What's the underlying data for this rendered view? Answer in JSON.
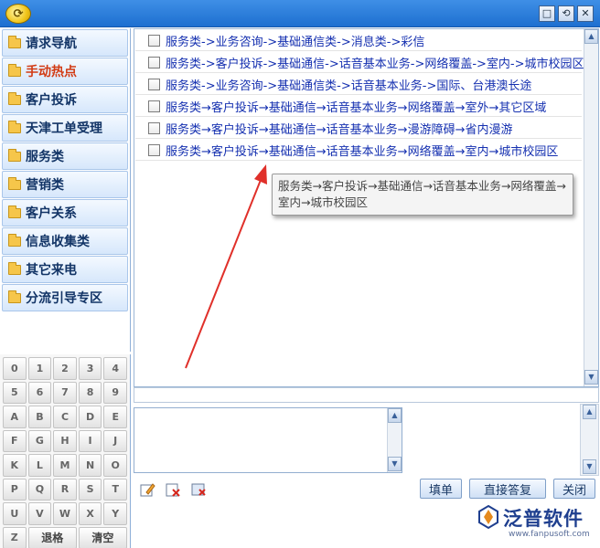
{
  "window": {
    "logo_glyph": "⟳",
    "controls": [
      "□",
      "⟲",
      "✕"
    ]
  },
  "sidebar": {
    "items": [
      {
        "label": "请求导航",
        "active": false
      },
      {
        "label": "手动热点",
        "active": true
      },
      {
        "label": "客户投诉",
        "active": false
      },
      {
        "label": "天津工单受理",
        "active": false
      },
      {
        "label": "服务类",
        "active": false
      },
      {
        "label": "营销类",
        "active": false
      },
      {
        "label": "客户关系",
        "active": false
      },
      {
        "label": "信息收集类",
        "active": false
      },
      {
        "label": "其它来电",
        "active": false
      },
      {
        "label": "分流引导专区",
        "active": false
      }
    ]
  },
  "keyboard": {
    "keys": [
      "0",
      "1",
      "2",
      "3",
      "4",
      "5",
      "6",
      "7",
      "8",
      "9",
      "A",
      "B",
      "C",
      "D",
      "E",
      "F",
      "G",
      "H",
      "I",
      "J",
      "K",
      "L",
      "M",
      "N",
      "O",
      "P",
      "Q",
      "R",
      "S",
      "T",
      "U",
      "V",
      "W",
      "X",
      "Y",
      "Z"
    ],
    "backspace_label": "退格",
    "clear_label": "清空"
  },
  "list": {
    "rows": [
      "服务类->业务咨询->基础通信类->消息类->彩信",
      "服务类->客户投诉->基础通信->话音基本业务->网络覆盖->室内->城市校园区",
      "服务类->业务咨询->基础通信类->话音基本业务->国际、台港澳长途",
      "服务类→客户投诉→基础通信→话音基本业务→网络覆盖→室外→其它区域",
      "服务类→客户投诉→基础通信→话音基本业务→漫游障碍→省内漫游",
      "服务类→客户投诉→基础通信→话音基本业务→网络覆盖→室内→城市校园区"
    ],
    "tooltip": "服务类→客户投诉→基础通信→话音基本业务→网络覆盖→室内→城市校园区"
  },
  "toolbar": {
    "fill_label": "填单",
    "reply_label": "直接答复",
    "close_label": "关闭"
  },
  "brand": {
    "name": "泛普软件",
    "url": "www.fanpusoft.com"
  },
  "colors": {
    "title_bar": "#1d6fd0",
    "list_text": "#1530b0",
    "active_nav": "#d23b14",
    "arrow": "#e0302a"
  }
}
